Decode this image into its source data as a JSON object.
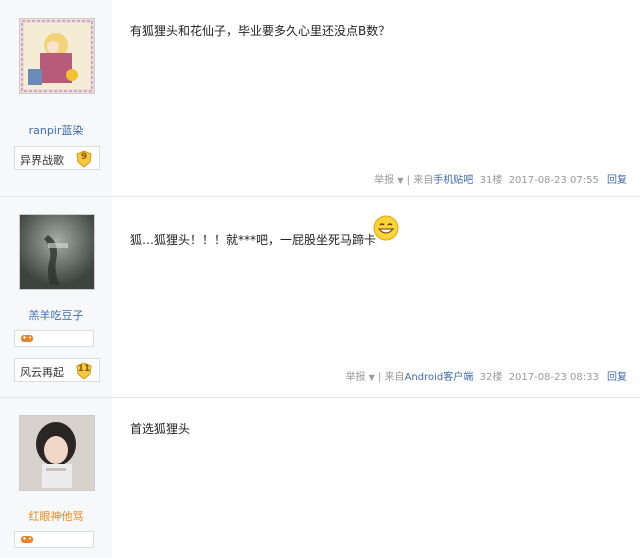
{
  "posts": [
    {
      "username": "ranpir蓝染",
      "forum_badge": "异界战歌",
      "forum_level": "9",
      "content": "有狐狸头和花仙子，毕业要多久心里还没点B数？",
      "report": "举报",
      "source_prefix": "| 来自",
      "source": "手机贴吧",
      "floor": "31楼",
      "time": "2017-08-23 07:55",
      "reply": "回复"
    },
    {
      "username": "羔羊吃豆子",
      "forum_badge": "风云再起",
      "forum_level": "11",
      "content": "狐…狐狸头！！！就***吧，一屁股坐死马蹄卡",
      "emoji_icon": "grin-emoji-icon",
      "report": "举报",
      "source_prefix": "| 来自",
      "source": "Android客户端",
      "floor": "32楼",
      "time": "2017-08-23 08:33",
      "reply": "回复"
    },
    {
      "username": "红眼神他骂",
      "content": "首选狐狸头"
    }
  ],
  "colors": {
    "link": "#3f6ab3",
    "orange_name": "#f08a1e",
    "meta": "#999999"
  }
}
